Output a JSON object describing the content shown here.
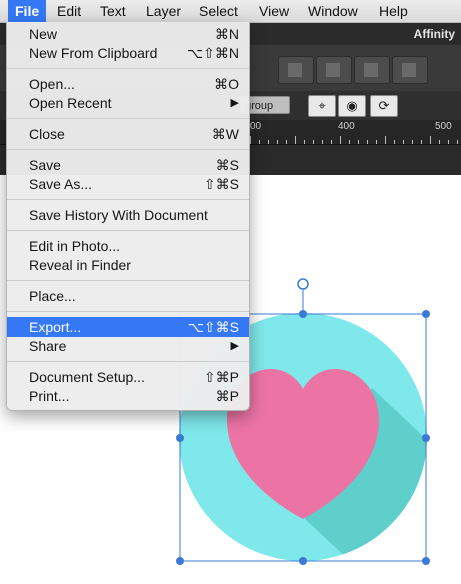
{
  "menubar": {
    "items": [
      {
        "label": "File"
      },
      {
        "label": "Edit"
      },
      {
        "label": "Text"
      },
      {
        "label": "Layer"
      },
      {
        "label": "Select"
      },
      {
        "label": "View"
      },
      {
        "label": "Window"
      },
      {
        "label": "Help"
      }
    ]
  },
  "app": {
    "title": "Affinity"
  },
  "context_toolbar": {
    "group_label": "group"
  },
  "ruler": {
    "labels": [
      "00",
      "400",
      "500"
    ]
  },
  "file_menu": {
    "items": [
      {
        "label": "New",
        "shortcut": "⌘N"
      },
      {
        "label": "New From Clipboard",
        "shortcut": "⌥⇧⌘N"
      },
      {
        "label": "Open...",
        "shortcut": "⌘O"
      },
      {
        "label": "Open Recent",
        "shortcut": "▶"
      },
      {
        "label": "Close",
        "shortcut": "⌘W"
      },
      {
        "label": "Save",
        "shortcut": "⌘S"
      },
      {
        "label": "Save As...",
        "shortcut": "⇧⌘S"
      },
      {
        "label": "Save History With Document",
        "shortcut": ""
      },
      {
        "label": "Edit in Photo...",
        "shortcut": ""
      },
      {
        "label": "Reveal in Finder",
        "shortcut": ""
      },
      {
        "label": "Place...",
        "shortcut": ""
      },
      {
        "label": "Export...",
        "shortcut": "⌥⇧⌘S"
      },
      {
        "label": "Share",
        "shortcut": "▶"
      },
      {
        "label": "Document Setup...",
        "shortcut": "⇧⌘P"
      },
      {
        "label": "Print...",
        "shortcut": "⌘P"
      }
    ],
    "highlighted": "Export..."
  },
  "colors": {
    "menu_highlight": "#3478f6",
    "circle": "#7fe8ea",
    "circle_shadow": "#5fcfcc",
    "heart": "#ec74a4",
    "selection": "#3a7ad6"
  },
  "icons": [
    "heart-icon",
    "snap-icon",
    "view-icon",
    "transform-icon"
  ]
}
